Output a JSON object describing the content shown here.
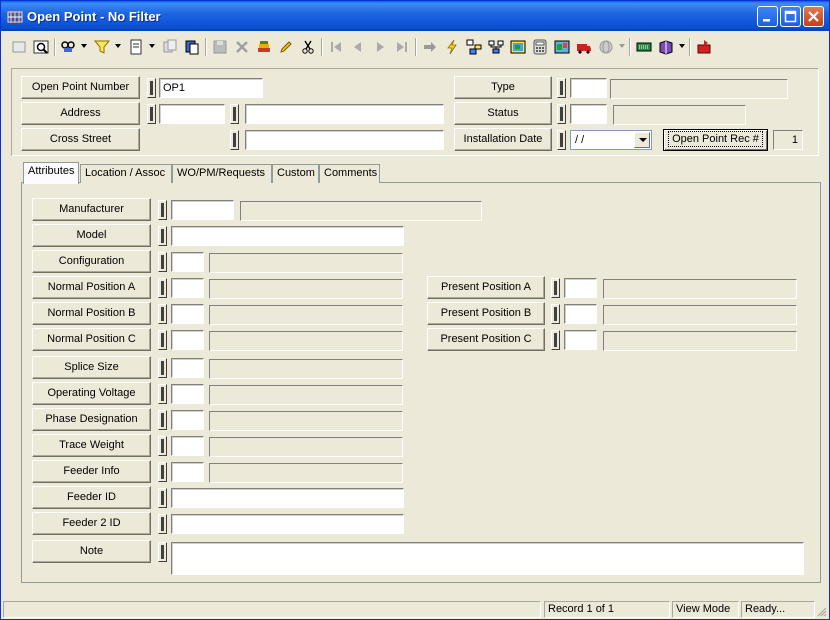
{
  "window": {
    "title": "Open Point - No Filter",
    "icon": "grid-app-icon",
    "controls": [
      "minimize-icon",
      "maximize-icon",
      "close-icon"
    ]
  },
  "toolbar": {
    "icons": [
      "new-record-icon",
      "find-icon",
      "search-dropdown-icon",
      "filter-icon",
      "report-icon",
      "copy-icon",
      "paste-icon",
      "save-icon",
      "delete-icon",
      "layers-icon",
      "edit-pencil-icon",
      "cut-icon",
      "first-record-icon",
      "previous-record-icon",
      "next-record-icon",
      "last-record-icon",
      "go-to-icon",
      "lightning-icon",
      "hierarchy-icon",
      "network-icon",
      "map-icon",
      "calculator-icon",
      "map-view-icon",
      "van-icon",
      "globe-icon",
      "keyboard-icon",
      "book-icon",
      "exit-icon"
    ]
  },
  "header": {
    "open_point_number": {
      "label": "Open Point Number",
      "value": "OP1"
    },
    "address": {
      "label": "Address",
      "value1": "",
      "value2": ""
    },
    "cross_street": {
      "label": "Cross Street",
      "value": ""
    },
    "type": {
      "label": "Type",
      "code": "",
      "description": ""
    },
    "status": {
      "label": "Status",
      "code": "",
      "description": ""
    },
    "installation_date": {
      "label": "Installation Date",
      "value": " / /"
    },
    "open_point_rec": {
      "label": "Open Point Rec #",
      "value": "1"
    }
  },
  "tabs": [
    {
      "label": "Attributes",
      "active": true
    },
    {
      "label": "Location / Assoc",
      "active": false
    },
    {
      "label": "WO/PM/Requests",
      "active": false
    },
    {
      "label": "Custom",
      "active": false
    },
    {
      "label": "Comments",
      "active": false
    }
  ],
  "attributes": {
    "manufacturer": {
      "label": "Manufacturer",
      "code": "",
      "description": ""
    },
    "model": {
      "label": "Model",
      "value": ""
    },
    "configuration": {
      "label": "Configuration",
      "code": "",
      "description": ""
    },
    "normal_position_a": {
      "label": "Normal Position A",
      "code": "",
      "description": ""
    },
    "normal_position_b": {
      "label": "Normal Position B",
      "code": "",
      "description": ""
    },
    "normal_position_c": {
      "label": "Normal Position C",
      "code": "",
      "description": ""
    },
    "splice_size": {
      "label": "Splice Size",
      "code": "",
      "description": ""
    },
    "operating_voltage": {
      "label": "Operating Voltage",
      "code": "",
      "description": ""
    },
    "phase_designation": {
      "label": "Phase Designation",
      "code": "",
      "description": ""
    },
    "trace_weight": {
      "label": "Trace Weight",
      "code": "",
      "description": ""
    },
    "feeder_info": {
      "label": "Feeder Info",
      "code": "",
      "description": ""
    },
    "feeder_id": {
      "label": "Feeder ID",
      "value": ""
    },
    "feeder_2_id": {
      "label": "Feeder 2 ID",
      "value": ""
    },
    "note": {
      "label": "Note",
      "value": ""
    },
    "present_position_a": {
      "label": "Present Position A",
      "code": "",
      "description": ""
    },
    "present_position_b": {
      "label": "Present Position B",
      "code": "",
      "description": ""
    },
    "present_position_c": {
      "label": "Present Position C",
      "code": "",
      "description": ""
    }
  },
  "statusbar": {
    "blank": "",
    "record": "Record 1 of 1",
    "mode": "View Mode",
    "state": "Ready..."
  }
}
